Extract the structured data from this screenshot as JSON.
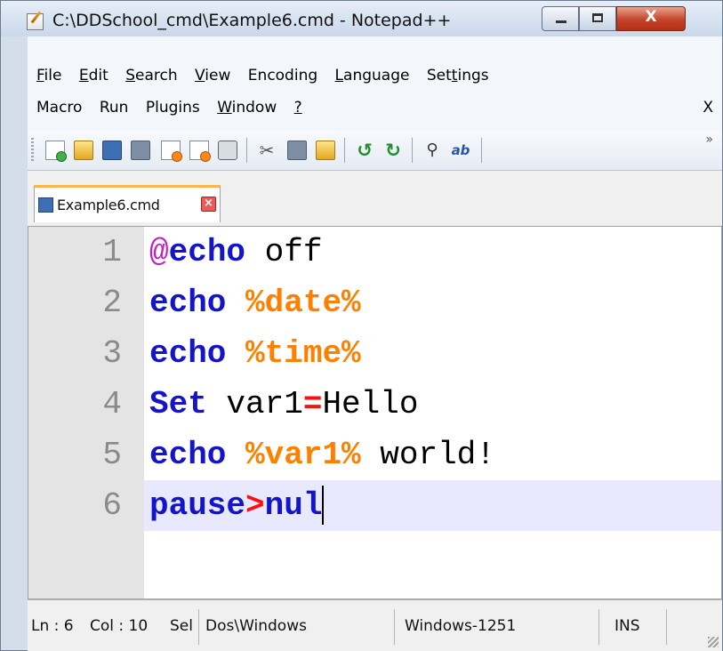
{
  "window": {
    "title": "C:\\DDSchool_cmd\\Example6.cmd - Notepad++",
    "close_glyph": "X"
  },
  "menu": {
    "row1": [
      "File",
      "Edit",
      "Search",
      "View",
      "Encoding",
      "Language",
      "Settings"
    ],
    "row2": [
      "Macro",
      "Run",
      "Plugins",
      "Window",
      "?"
    ],
    "close_label": "X"
  },
  "toolbar": {
    "icons": [
      "new-file-icon",
      "open-file-icon",
      "save-icon",
      "save-all-icon",
      "close-icon",
      "close-all-icon",
      "print-icon",
      "cut-icon",
      "copy-icon",
      "paste-icon",
      "undo-icon",
      "redo-icon",
      "find-icon",
      "replace-icon"
    ],
    "more_glyph": "»"
  },
  "tabs": [
    {
      "label": "Example6.cmd",
      "active": true
    }
  ],
  "editor": {
    "lines": [
      {
        "num": "1",
        "tokens": [
          {
            "t": "@",
            "c": "at-magenta"
          },
          {
            "t": "echo",
            "c": "kw-blue"
          },
          {
            "t": " off",
            "c": "plain"
          }
        ]
      },
      {
        "num": "2",
        "tokens": [
          {
            "t": "echo",
            "c": "kw-blue"
          },
          {
            "t": " ",
            "c": "plain"
          },
          {
            "t": "%date%",
            "c": "kw-orange"
          }
        ]
      },
      {
        "num": "3",
        "tokens": [
          {
            "t": "echo",
            "c": "kw-blue"
          },
          {
            "t": " ",
            "c": "plain"
          },
          {
            "t": "%time%",
            "c": "kw-orange"
          }
        ]
      },
      {
        "num": "4",
        "tokens": [
          {
            "t": "Set",
            "c": "kw-blue"
          },
          {
            "t": " var1",
            "c": "plain"
          },
          {
            "t": "=",
            "c": "op-red"
          },
          {
            "t": "Hello",
            "c": "plain"
          }
        ]
      },
      {
        "num": "5",
        "tokens": [
          {
            "t": "echo",
            "c": "kw-blue"
          },
          {
            "t": " ",
            "c": "plain"
          },
          {
            "t": "%var1%",
            "c": "kw-orange"
          },
          {
            "t": " world!",
            "c": "plain"
          }
        ]
      },
      {
        "num": "6",
        "tokens": [
          {
            "t": "pause",
            "c": "kw-blue"
          },
          {
            "t": ">",
            "c": "op-red"
          },
          {
            "t": "nul",
            "c": "kw-blue"
          }
        ]
      }
    ],
    "current_line": 6
  },
  "status": {
    "ln": "Ln : 6",
    "col": "Col : 10",
    "sel": "Sel",
    "eol": "Dos\\Windows",
    "encoding": "Windows-1251",
    "mode": "INS"
  }
}
